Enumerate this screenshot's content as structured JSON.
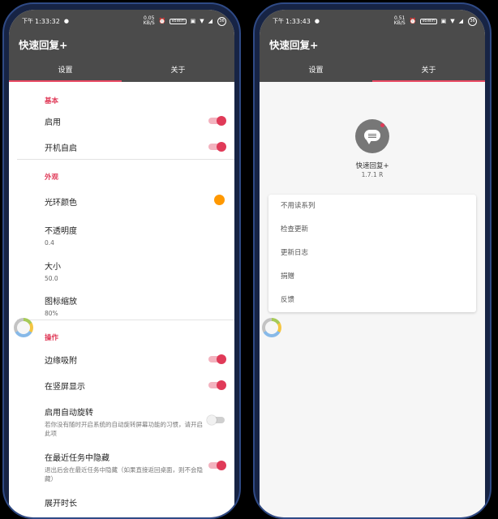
{
  "status_bar_left": {
    "period": "下午",
    "time": "1:33:32",
    "net": "0.05",
    "net_unit": "KB/S",
    "vowifi": "VoWiFi",
    "battery": "36"
  },
  "status_bar_right": {
    "period": "下午",
    "time": "1:33:43",
    "net": "0.51",
    "net_unit": "KB/S",
    "vowifi": "VoWiFi",
    "battery": "36"
  },
  "app_title": "快速回复+",
  "tabs": [
    "设置",
    "关于"
  ],
  "settings": {
    "basic": {
      "title": "基本",
      "enable": {
        "label": "启用",
        "on": true
      },
      "boot": {
        "label": "开机自启",
        "on": true
      }
    },
    "appearance": {
      "title": "外观",
      "ring_color": {
        "label": "光环颜色",
        "color": "#ff9800"
      },
      "opacity": {
        "label": "不透明度",
        "value": "0.4"
      },
      "size": {
        "label": "大小",
        "value": "50.0"
      },
      "icon_scale": {
        "label": "图标缩放",
        "value": "80%"
      }
    },
    "operation": {
      "title": "操作",
      "edge_snap": {
        "label": "边缘吸附",
        "on": true
      },
      "portrait": {
        "label": "在竖屏显示",
        "on": true
      },
      "auto_rotate": {
        "label": "启用自动旋转",
        "desc": "若你没有随时开启系统的自动旋转屏幕功能的习惯，请开启此项",
        "on": false
      },
      "hide_recent": {
        "label": "在最近任务中隐藏",
        "desc": "退出后会在最近任务中隐藏（如果直接返回桌面，则不会隐藏）",
        "on": true
      },
      "expand_duration": {
        "label": "展开时长"
      }
    }
  },
  "about": {
    "app_name": "快速回复+",
    "version": "1.7.1 R",
    "items": [
      "不用读系列",
      "检查更新",
      "更新日志",
      "捐赠",
      "反馈"
    ]
  },
  "colors": {
    "accent": "#e03a58",
    "appbar": "#4b4b4b",
    "ring_color": "#ff9800"
  }
}
